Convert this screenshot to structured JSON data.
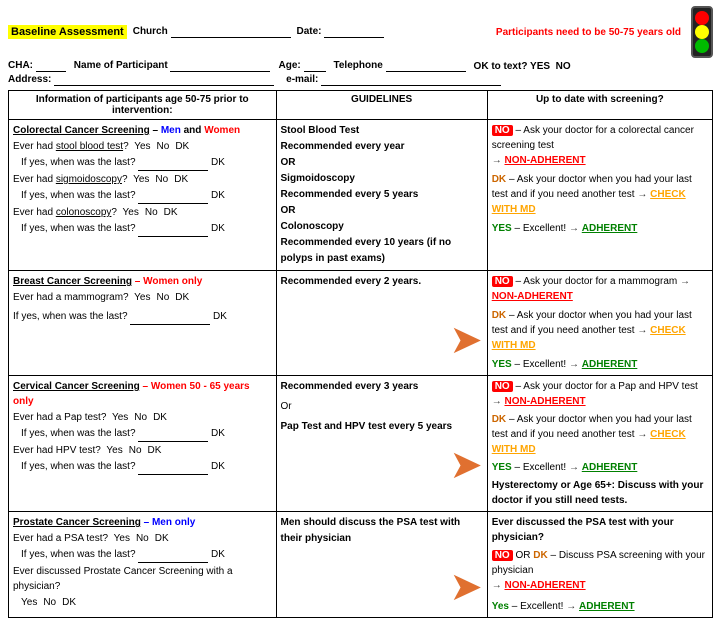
{
  "header": {
    "baseline_label": "Baseline Assessment",
    "church_label": "Church",
    "date_label": "Date:",
    "warning": "Participants need to be 50-75 years old",
    "row2": {
      "cha_label": "CHA:",
      "name_label": "Name of Participant",
      "age_label": "Age:",
      "telephone_label": "Telephone",
      "oktext_label": "OK to text? YES  NO"
    },
    "row3": {
      "address_label": "Address:",
      "email_label": "e-mail:"
    }
  },
  "table": {
    "col1_header": "Information of participants age 50-75 prior to intervention:",
    "col2_header": "GUIDELINES",
    "col3_header": "Up to date with screening?",
    "sections": [
      {
        "id": "colorectal",
        "title": "Colorectal Cancer Screening",
        "title_suffix": " – Men and Women",
        "rows": [
          {
            "label": "Ever had stool blood test?",
            "yn": true
          },
          {
            "label": "If yes, when was the last?",
            "yn": false,
            "blank": true
          },
          {
            "label": "Ever had sigmoidoscopy?",
            "yn": true
          },
          {
            "label": "If yes, when was the last?",
            "yn": false,
            "blank": true
          },
          {
            "label": "Ever had colonoscopy?",
            "yn": true
          },
          {
            "label": "If yes, when was the last?",
            "yn": false,
            "blank": true
          }
        ],
        "guidelines": {
          "lines": [
            {
              "text": "Stool Blood Test",
              "bold": true
            },
            {
              "text": "Recommended every year",
              "bold": true
            },
            {
              "text": "OR",
              "bold": true
            },
            {
              "text": "Sigmoidoscopy",
              "bold": true
            },
            {
              "text": "Recommended every 5 years",
              "bold": true
            },
            {
              "text": "OR",
              "bold": true
            },
            {
              "text": "Colonoscopy",
              "bold": true
            },
            {
              "text": "Recommended every 10 years (if no polyps in past exams)",
              "bold": true
            }
          ]
        },
        "uptodate": {
          "lines": [
            {
              "type": "no",
              "text": " – Ask your doctor for a colorectal cancer screening test"
            },
            {
              "type": "arrow-nonadherent",
              "text": "NON-ADHERENT"
            },
            {
              "type": "spacer"
            },
            {
              "type": "dk",
              "text": " – Ask your doctor when you had your last test and if you need another test "
            },
            {
              "type": "arrow-checkmd",
              "text": "CHECK WITH MD"
            },
            {
              "type": "spacer"
            },
            {
              "type": "yes",
              "text": " – Excellent!   "
            },
            {
              "type": "arrow-adherent",
              "text": "ADHERENT"
            }
          ]
        }
      },
      {
        "id": "breast",
        "title": "Breast Cancer Screening",
        "title_suffix": " – Women only",
        "rows": [
          {
            "label": "Ever had a mammogram?",
            "yn": true
          },
          {
            "label": "If yes, when was the last?",
            "yn": false,
            "blank": true
          }
        ],
        "guidelines": {
          "lines": [
            {
              "text": "Recommended every 2 years.",
              "bold": true
            }
          ],
          "has_big_arrow": true
        },
        "uptodate": {
          "lines": [
            {
              "type": "no",
              "text": " – Ask your doctor for a mammogram "
            },
            {
              "type": "arrow-nonadherent",
              "text": "NON-ADHERENT"
            },
            {
              "type": "dk",
              "text": " – Ask your doctor when you had your last test and if you need another test "
            },
            {
              "type": "arrow-checkmd",
              "text": "CHECK WITH MD"
            },
            {
              "type": "yes",
              "text": " – Excellent!   "
            },
            {
              "type": "arrow-adherent",
              "text": "ADHERENT"
            }
          ]
        }
      },
      {
        "id": "cervical",
        "title": "Cervical Cancer Screening",
        "title_suffix": " – Women 50 - 65 years only",
        "rows": [
          {
            "label": "Ever had a Pap test?",
            "yn": true
          },
          {
            "label": "If yes, when was the last?",
            "yn": false,
            "blank": true
          },
          {
            "label": "Ever had HPV test?",
            "yn": true
          },
          {
            "label": "If yes, when was the last?",
            "yn": false,
            "blank": true
          }
        ],
        "guidelines": {
          "lines": [
            {
              "text": "Recommended every 3 years",
              "bold": true
            },
            {
              "text": "Or",
              "bold": false
            },
            {
              "text": "Pap Test and HPV test every 5 years",
              "bold": true
            }
          ],
          "has_big_arrow": true
        },
        "uptodate": {
          "lines": [
            {
              "type": "no",
              "text": " – Ask your doctor for a Pap and HPV test "
            },
            {
              "type": "arrow-nonadherent",
              "text": "NON-ADHERENT"
            },
            {
              "type": "dk",
              "text": " – Ask your doctor when you had your last test and if you need another test "
            },
            {
              "type": "arrow-checkmd",
              "text": "CHECK WITH MD"
            },
            {
              "type": "yes",
              "text": " – Excellent!   "
            },
            {
              "type": "arrow-adherent",
              "text": "ADHERENT"
            },
            {
              "type": "special",
              "text": "Hysterectomy or Age 65+: Discuss with your doctor if you still need tests."
            }
          ]
        }
      },
      {
        "id": "prostate",
        "title": "Prostate Cancer Screening",
        "title_suffix": " – Men only",
        "rows": [
          {
            "label": "Ever had a PSA test?",
            "yn": true
          },
          {
            "label": "If yes, when was the last?",
            "yn": false,
            "blank": true
          },
          {
            "label": "Ever discussed Prostate Cancer Screening with a physician?",
            "yn": false,
            "yn_below": true
          }
        ],
        "guidelines": {
          "lines": [
            {
              "text": "Men should discuss the PSA test with their physician",
              "bold": true
            }
          ],
          "has_big_arrow": true
        },
        "uptodate": {
          "lines": [
            {
              "type": "bold-text",
              "text": "Ever discussed the PSA test with your physician?"
            },
            {
              "type": "no",
              "text": " OR "
            },
            {
              "type": "dk-inline",
              "text": "DK"
            },
            {
              "type": "discuss-text",
              "text": " – Discuss PSA screening with your physician"
            },
            {
              "type": "arrow-nonadherent",
              "text": "NON-ADHERENT"
            },
            {
              "type": "spacer"
            },
            {
              "type": "yes",
              "text": " – Excellent!  "
            },
            {
              "type": "arrow-adherent",
              "text": "ADHERENT"
            }
          ]
        }
      }
    ]
  }
}
